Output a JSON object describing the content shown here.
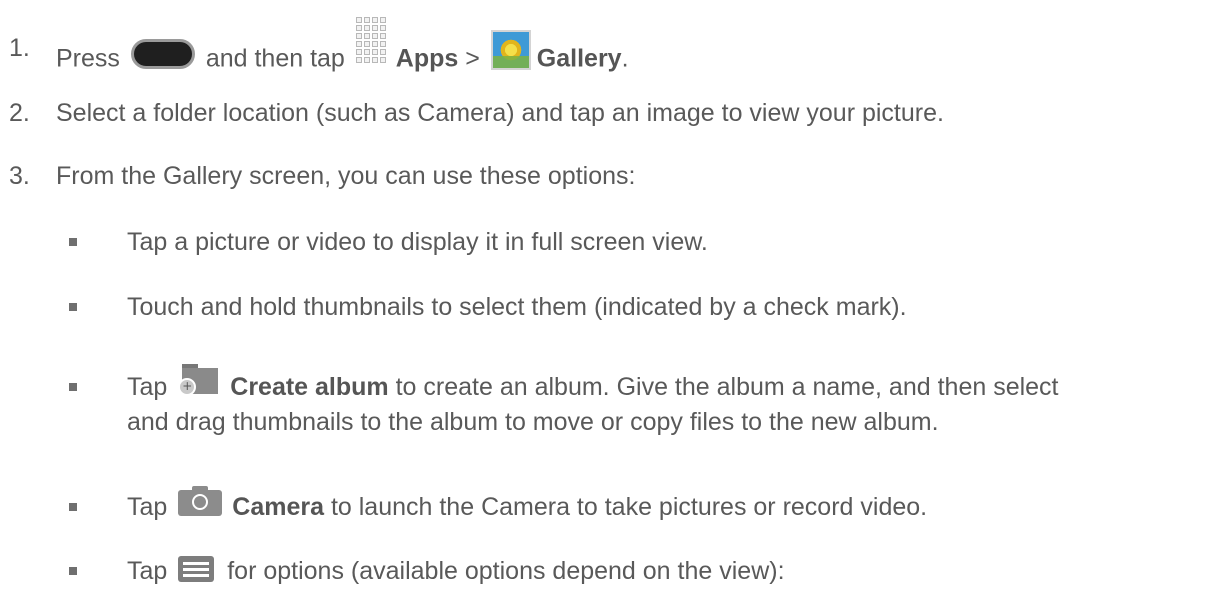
{
  "steps": [
    {
      "number": "1.",
      "prefix": "Press",
      "middle": "and then tap",
      "apps_label": "Apps",
      "separator": ">",
      "gallery_label": "Gallery",
      "end": "."
    },
    {
      "number": "2.",
      "text": "Select a folder location (such as Camera) and tap an image to view your picture."
    },
    {
      "number": "3.",
      "text": "From the Gallery screen, you can use these options:"
    }
  ],
  "bullets": [
    {
      "text": "Tap a picture or video to display it in full screen view."
    },
    {
      "text": "Touch and hold thumbnails to select them (indicated by a check mark)."
    },
    {
      "prefix": "Tap",
      "bold": "Create album",
      "rest": "to create an album. Give the album a name, and then select",
      "line2": "and drag thumbnails to the album to move or copy files to the new album."
    },
    {
      "prefix": "Tap",
      "bold": "Camera",
      "rest": "to launch the Camera to take pictures or record video."
    },
    {
      "prefix": "Tap",
      "rest": "for options (available options depend on the view):"
    }
  ],
  "icons": {
    "home_button": "home-button-icon",
    "apps": "apps-grid-icon",
    "gallery": "gallery-icon",
    "create_album": "folder-plus-icon",
    "camera": "camera-icon",
    "menu": "menu-icon"
  },
  "colors": {
    "text": "#595959",
    "bullet": "#6f6f6f"
  }
}
